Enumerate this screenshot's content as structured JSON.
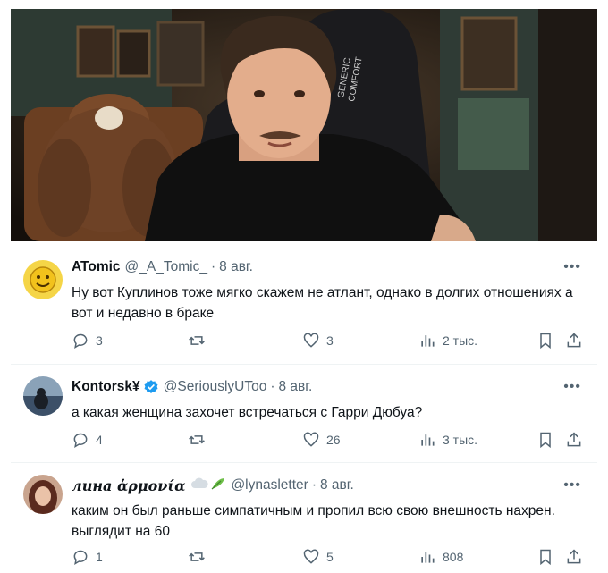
{
  "video": {
    "chair_text_line1": "GENERIC",
    "chair_text_line2": "COMFORT"
  },
  "tweets": [
    {
      "name": "ATomic",
      "handle": "@_A_Tomic_",
      "date": "8 авг.",
      "text": "Ну вот Куплинов тоже мягко скажем не атлант, однако в долгих отношениях а вот и недавно в браке",
      "replies": "3",
      "retweets": "",
      "likes": "3",
      "views": "2 тыс."
    },
    {
      "name": "Kontorsk¥",
      "handle": "@SeriouslyUToo",
      "date": "8 авг.",
      "text": "а какая женщина захочет встречаться с Гарри Дюбуа?",
      "replies": "4",
      "retweets": "",
      "likes": "26",
      "views": "3 тыс."
    },
    {
      "name": "лина ἁρμονία",
      "handle": "@lynasletter",
      "date": "8 авг.",
      "text": "каким он был раньше симпатичным и пропил всю свою внешность нахрен. выглядит на 60",
      "replies": "1",
      "retweets": "",
      "likes": "5",
      "views": "808"
    }
  ],
  "icons": {
    "more": "more-dots-icon",
    "reply": "reply-icon",
    "retweet": "retweet-icon",
    "like": "heart-icon",
    "views": "views-chart-icon",
    "bookmark": "bookmark-icon",
    "share": "share-icon",
    "verified": "verified-badge-icon"
  },
  "colors": {
    "text": "#0f1419",
    "secondary": "#536471",
    "verified": "#1d9bf0",
    "divider": "#eff3f4"
  }
}
